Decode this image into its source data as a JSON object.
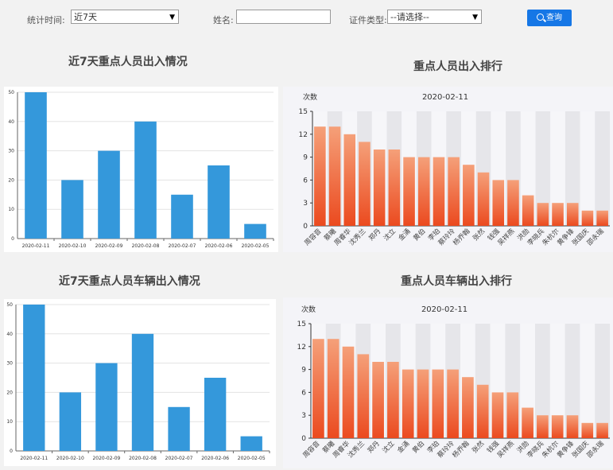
{
  "filter": {
    "period_label": "统计时间:",
    "period_value": "近7天",
    "name_label": "姓名:",
    "name_value": "",
    "idtype_label": "证件类型:",
    "idtype_value": "--请选择--",
    "search_button": "查询"
  },
  "sections": {
    "person_inout_title": "近7天重点人员出入情况",
    "person_rank_title": "重点人员出入排行",
    "vehicle_inout_title": "近7天重点人员车辆出入情况",
    "vehicle_rank_title": "重点人员车辆出入排行"
  },
  "colors": {
    "bar_blue": "#3498db",
    "rank_top": "#f5a079",
    "rank_bottom": "#eb4a1f",
    "button": "#1677e6"
  },
  "chart_data": [
    {
      "id": "person_inout",
      "type": "bar",
      "categories": [
        "2020-02-11",
        "2020-02-10",
        "2020-02-09",
        "2020-02-08",
        "2020-02-07",
        "2020-02-06",
        "2020-02-05"
      ],
      "values": [
        50,
        20,
        30,
        40,
        15,
        25,
        5
      ],
      "ylim": [
        0,
        50
      ],
      "yticks": [
        0,
        10,
        20,
        30,
        40,
        50
      ],
      "grid": true
    },
    {
      "id": "person_rank",
      "type": "bar",
      "title": "2020-02-11",
      "ylabel": "次数",
      "categories": [
        "周容音",
        "蔡曦",
        "周睿华",
        "沈秀兰",
        "郑丹",
        "沈立",
        "金涌",
        "黄伯",
        "李珀",
        "蔡玲玲",
        "杨乔翰",
        "张然",
        "钱强",
        "吴祥燕",
        "洪勋",
        "李晓兵",
        "朱杭尔",
        "黄争锋",
        "张国庆",
        "邵永瑞"
      ],
      "values": [
        13,
        13,
        12,
        11,
        10,
        10,
        9,
        9,
        9,
        9,
        8,
        7,
        6,
        6,
        4,
        3,
        3,
        3,
        2,
        2
      ],
      "ylim": [
        0,
        15
      ],
      "yticks": [
        0,
        3,
        6,
        9,
        12,
        15
      ],
      "grid": true
    },
    {
      "id": "vehicle_inout",
      "type": "bar",
      "categories": [
        "2020-02-11",
        "2020-02-10",
        "2020-02-09",
        "2020-02-08",
        "2020-02-07",
        "2020-02-06",
        "2020-02-05"
      ],
      "values": [
        50,
        20,
        30,
        40,
        15,
        25,
        5
      ],
      "ylim": [
        0,
        50
      ],
      "yticks": [
        0,
        10,
        20,
        30,
        40,
        50
      ],
      "grid": true
    },
    {
      "id": "vehicle_rank",
      "type": "bar",
      "title": "2020-02-11",
      "ylabel": "次数",
      "categories": [
        "周容音",
        "蔡曦",
        "周睿华",
        "沈秀兰",
        "郑丹",
        "沈立",
        "金涌",
        "黄伯",
        "李珀",
        "蔡玲玲",
        "杨乔翰",
        "张然",
        "钱强",
        "吴祥燕",
        "洪勋",
        "李晓兵",
        "朱杭尔",
        "黄争锋",
        "张国庆",
        "邵永瑞"
      ],
      "values": [
        13,
        13,
        12,
        11,
        10,
        10,
        9,
        9,
        9,
        9,
        8,
        7,
        6,
        6,
        4,
        3,
        3,
        3,
        2,
        2
      ],
      "ylim": [
        0,
        15
      ],
      "yticks": [
        0,
        3,
        6,
        9,
        12,
        15
      ],
      "grid": true
    }
  ]
}
